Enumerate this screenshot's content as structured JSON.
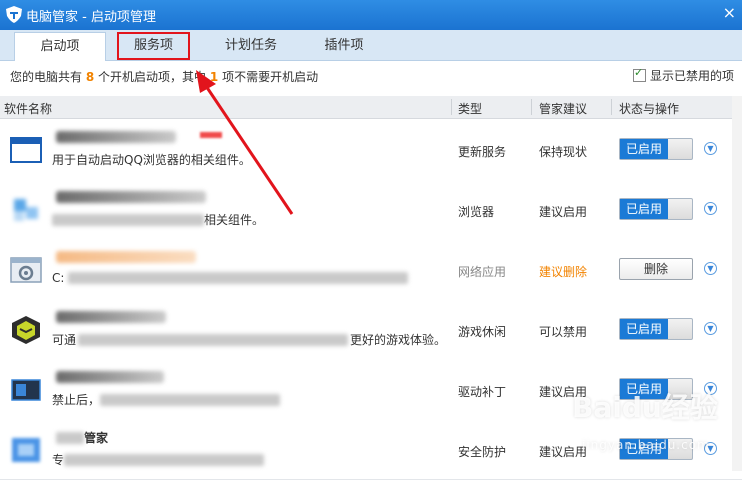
{
  "window": {
    "title": "电脑管家 - 启动项管理",
    "close_label": "×"
  },
  "tabs": [
    {
      "label": "启动项",
      "active": true
    },
    {
      "label": "服务项",
      "active": false,
      "highlighted": true
    },
    {
      "label": "计划任务",
      "active": false
    },
    {
      "label": "插件项",
      "active": false
    }
  ],
  "summary": {
    "prefix": "您的电脑共有",
    "total": "8",
    "mid": "个开机启动项，其中",
    "unneeded": "1",
    "suffix": "项不需要开机启动"
  },
  "show_disabled": {
    "label": "显示已禁用的项",
    "checked": true
  },
  "columns": {
    "name": "软件名称",
    "type": "类型",
    "advice": "管家建议",
    "status": "状态与操作"
  },
  "rows": [
    {
      "icon": "browser-window-icon",
      "desc": "用于自动启动QQ浏览器的相关组件。",
      "type": "更新服务",
      "advice": "保持现状",
      "status": "已启用"
    },
    {
      "icon": "puzzle-icon",
      "desc": "相关组件。",
      "type": "浏览器",
      "advice": "建议启用",
      "status": "已启用"
    },
    {
      "icon": "gear-window-icon",
      "desc": "C:",
      "type": "网络应用",
      "advice": "建议删除",
      "status": "删除"
    },
    {
      "icon": "game-cube-icon",
      "desc_pre": "可通",
      "desc": "更好的游戏体验。",
      "type": "游戏休闲",
      "advice": "可以禁用",
      "status": "已启用"
    },
    {
      "icon": "driver-icon",
      "desc_pre": "禁止后，",
      "type": "驱动补丁",
      "advice": "建议启用",
      "status": "已启用"
    },
    {
      "icon": "manager-shield-icon",
      "name_suffix": "管家",
      "desc_pre": "专",
      "type": "安全防护",
      "advice": "建议启用",
      "status": "已启用"
    }
  ],
  "watermark": {
    "brand": "Baidu经验",
    "site": "jingyan.baidu.com"
  },
  "colors": {
    "accent": "#1b7ad6",
    "warn": "#f28300",
    "highlight": "#e2141c"
  }
}
